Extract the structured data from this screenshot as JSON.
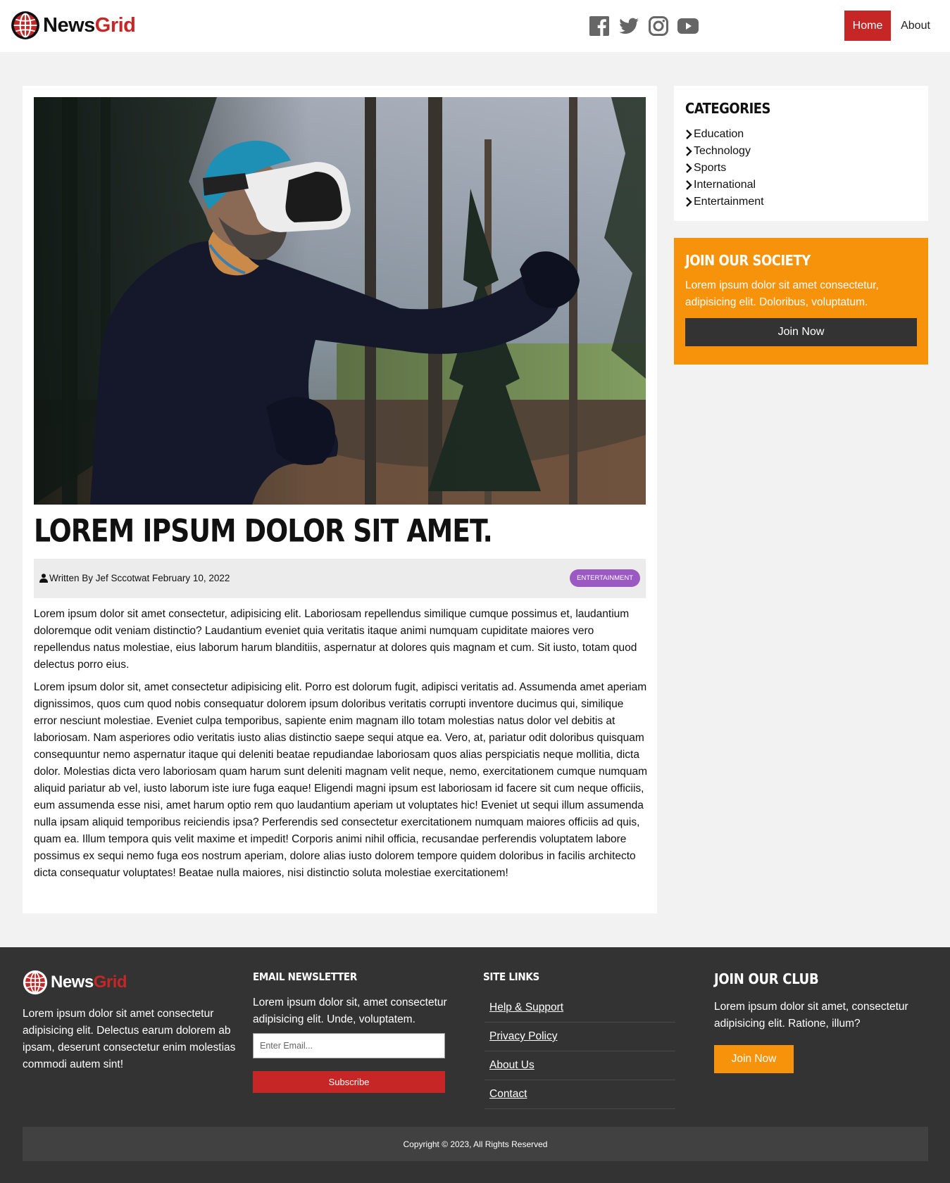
{
  "header": {
    "logo": {
      "part1": "News",
      "part2": "Grid"
    },
    "social": [
      "facebook-icon",
      "twitter-icon",
      "instagram-icon",
      "youtube-icon"
    ],
    "nav": {
      "home": "Home",
      "about": "About"
    }
  },
  "article": {
    "title": "LOREM IPSUM DOLOR SIT AMET.",
    "meta": "Written By Jef Sccotwat February 10, 2022",
    "badge": "ENTERTAINMENT",
    "paragraphs": [
      "Lorem ipsum dolor sit amet consectetur, adipisicing elit. Laboriosam repellendus similique cumque possimus et, laudantium doloremque odit veniam distinctio? Laudantium eveniet quia veritatis itaque animi numquam cupiditate maiores vero repellendus natus molestiae, eius laborum harum blanditiis, aspernatur at dolores quis magnam et cum. Sit iusto, totam quod delectus porro eius.",
      "Lorem ipsum dolor sit, amet consectetur adipisicing elit. Porro est dolorum fugit, adipisci veritatis ad. Assumenda amet aperiam dignissimos, quos cum quod nobis consequatur dolorem ipsum doloribus veritatis corrupti inventore ducimus qui, similique error nesciunt molestiae. Eveniet culpa temporibus, sapiente enim magnam illo totam molestias natus dolor vel debitis at laboriosam. Nam asperiores odio veritatis iusto alias distinctio saepe sequi atque ea. Vero, at, pariatur odit doloribus quisquam consequuntur nemo aspernatur itaque qui deleniti beatae repudiandae laboriosam quos alias perspiciatis neque mollitia, dicta dolor. Molestias dicta vero laboriosam quam harum sunt deleniti magnam velit neque, nemo, exercitationem cumque numquam aliquid pariatur ab vel, iusto laborum iste iure fuga eaque! Eligendi magni ipsum est laboriosam id facere sit cum neque officiis, eum assumenda esse nisi, amet harum optio rem quo laudantium aperiam ut voluptates hic! Eveniet ut sequi illum assumenda nulla ipsam aliquid temporibus reiciendis ipsa? Perferendis sed consectetur exercitationem numquam maiores officiis ad quis, quam ea. Illum tempora quis velit maxime et impedit! Corporis animi nihil officia, recusandae perferendis voluptatem labore possimus ex sequi nemo fuga eos nostrum aperiam, dolore alias iusto dolorem tempore quidem doloribus in facilis architecto dicta consequatur voluptates! Beatae nulla maiores, nisi distinctio soluta molestiae exercitationem!"
    ]
  },
  "sidebar": {
    "categories": {
      "heading": "CATEGORIES",
      "items": [
        "Education",
        "Technology",
        "Sports",
        "International",
        "Entertainment"
      ]
    },
    "join": {
      "heading": "JOIN OUR SOCIETY",
      "text": "Lorem ipsum dolor sit amet consectetur, adipisicing elit. Doloribus, voluptatum.",
      "button": "Join Now"
    }
  },
  "footer": {
    "logo": {
      "part1": "News",
      "part2": "Grid"
    },
    "about_text": "Lorem ipsum dolor sit amet consectetur adipisicing elit. Delectus earum dolorem ab ipsam, deserunt consectetur enim molestias commodi autem sint!",
    "newsletter": {
      "heading": "EMAIL NEWSLETTER",
      "text": "Lorem ipsum dolor sit, amet consectetur adipisicing elit. Unde, voluptatem.",
      "placeholder": "Enter Email...",
      "button": "Subscribe"
    },
    "links": {
      "heading": "SITE LINKS",
      "items": [
        "Help & Support",
        "Privacy Policy",
        "About Us",
        "Contact"
      ]
    },
    "club": {
      "heading": "JOIN OUR CLUB",
      "text": "Lorem ipsum dolor sit amet, consectetur adipisicing elit. Ratione, illum?",
      "button": "Join Now"
    },
    "copyright": "Copyright © 2023, All Rights Reserved"
  },
  "colors": {
    "brand_red": "#c62626",
    "accent_orange": "#f7930a",
    "badge_purple": "#9b59c2",
    "footer_dark": "#333333"
  }
}
